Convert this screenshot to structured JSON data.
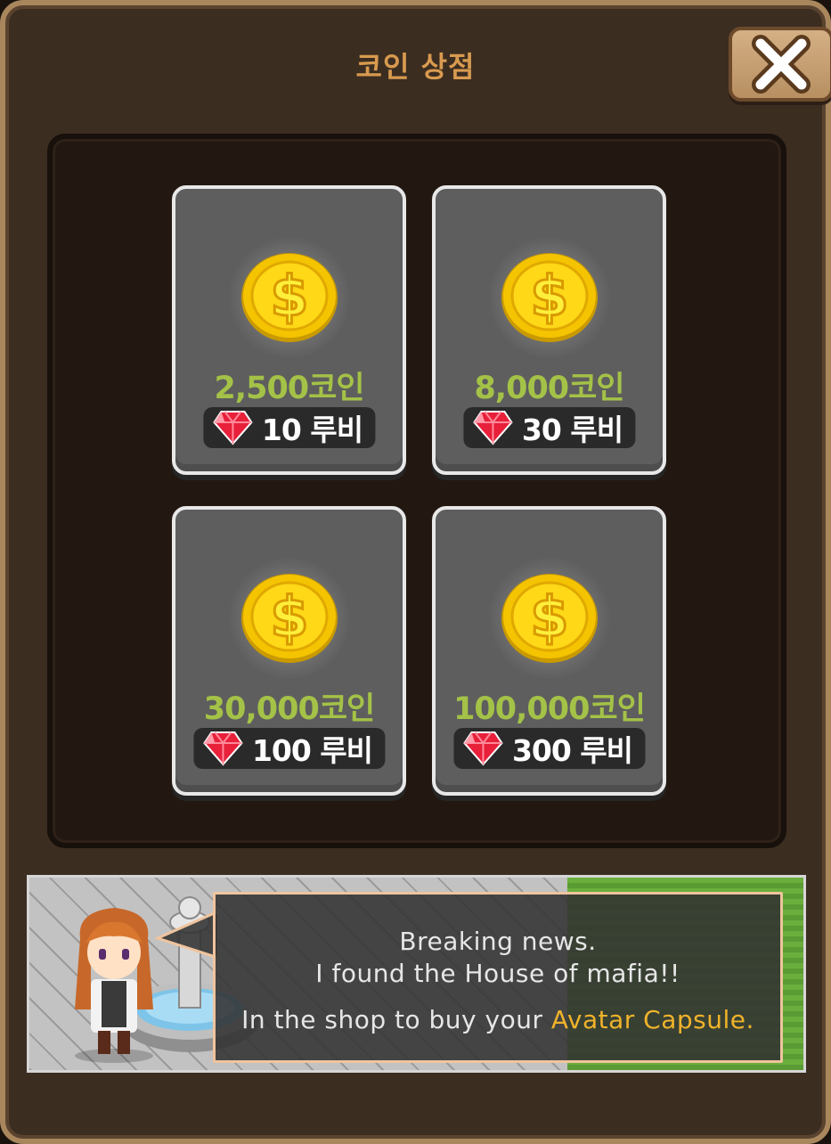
{
  "shop": {
    "title": "코인 상점"
  },
  "products": [
    {
      "coins": "2,500코인",
      "price": "10 루비"
    },
    {
      "coins": "8,000코인",
      "price": "30 루비"
    },
    {
      "coins": "30,000코인",
      "price": "100 루비"
    },
    {
      "coins": "100,000코인",
      "price": "300 루비"
    }
  ],
  "banner": {
    "line1": "Breaking news.",
    "line2": "I found the House of mafia!!",
    "line3_prefix": "In the shop to buy your ",
    "line3_highlight": "Avatar Capsule."
  },
  "colors": {
    "coin_text": "#a4c247",
    "title": "#d89a4f",
    "highlight": "#f0b32a"
  }
}
